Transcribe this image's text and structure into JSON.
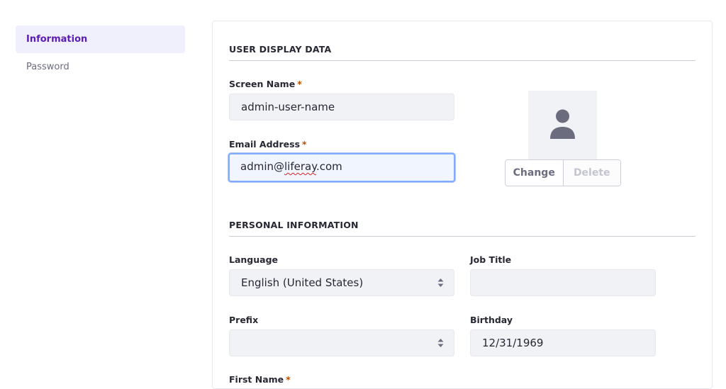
{
  "sidebar": {
    "items": [
      {
        "label": "Information"
      },
      {
        "label": "Password"
      }
    ]
  },
  "user_display": {
    "section_title": "USER DISPLAY DATA",
    "screen_name": {
      "label": "Screen Name",
      "value": "admin-user-name"
    },
    "email": {
      "label": "Email Address",
      "value_prefix": "admin@",
      "value_misspelled": "liferay",
      "value_suffix": ".com"
    },
    "required_marker": "*",
    "avatar": {
      "icon": "user-silhouette-icon"
    },
    "change_label": "Change",
    "delete_label": "Delete"
  },
  "personal": {
    "section_title": "PERSONAL INFORMATION",
    "language": {
      "label": "Language",
      "value": "English (United States)"
    },
    "job_title": {
      "label": "Job Title",
      "value": ""
    },
    "prefix": {
      "label": "Prefix",
      "value": ""
    },
    "birthday": {
      "label": "Birthday",
      "value": "12/31/1969"
    },
    "first_name": {
      "label": "First Name"
    }
  },
  "colors": {
    "accent": "#5b1bb5",
    "required": "#b95000",
    "focus_border": "#80acff"
  }
}
